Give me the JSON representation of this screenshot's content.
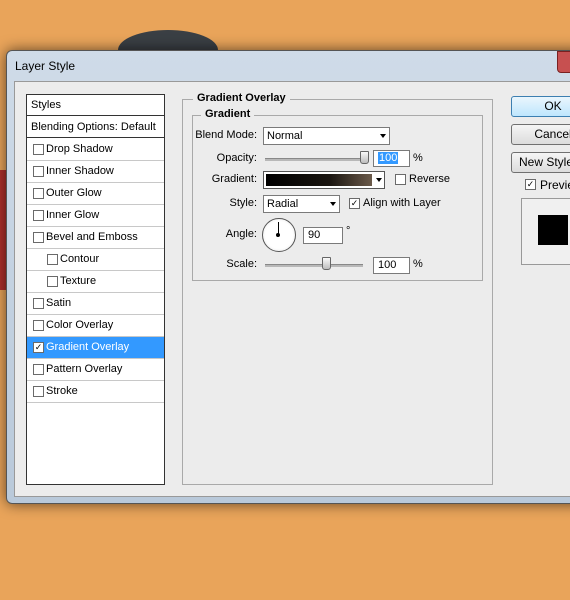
{
  "window": {
    "title": "Layer Style"
  },
  "sidebar": {
    "items": [
      {
        "label": "Styles",
        "checkbox": false,
        "checked": false
      },
      {
        "label": "Blending Options: Default",
        "checkbox": false,
        "checked": false
      },
      {
        "label": "Drop Shadow",
        "checkbox": true,
        "checked": false
      },
      {
        "label": "Inner Shadow",
        "checkbox": true,
        "checked": false
      },
      {
        "label": "Outer Glow",
        "checkbox": true,
        "checked": false
      },
      {
        "label": "Inner Glow",
        "checkbox": true,
        "checked": false
      },
      {
        "label": "Bevel and Emboss",
        "checkbox": true,
        "checked": false
      },
      {
        "label": "Contour",
        "checkbox": true,
        "checked": false
      },
      {
        "label": "Texture",
        "checkbox": true,
        "checked": false
      },
      {
        "label": "Satin",
        "checkbox": true,
        "checked": false
      },
      {
        "label": "Color Overlay",
        "checkbox": true,
        "checked": false
      },
      {
        "label": "Gradient Overlay",
        "checkbox": true,
        "checked": true
      },
      {
        "label": "Pattern Overlay",
        "checkbox": true,
        "checked": false
      },
      {
        "label": "Stroke",
        "checkbox": true,
        "checked": false
      }
    ]
  },
  "panel": {
    "section_title": "Gradient Overlay",
    "group_title": "Gradient",
    "blend_mode_label": "Blend Mode:",
    "blend_mode_value": "Normal",
    "opacity_label": "Opacity:",
    "opacity_value": "100",
    "opacity_unit": "%",
    "opacity_level": 1.0,
    "gradient_label": "Gradient:",
    "reverse_label": "Reverse",
    "reverse_checked": false,
    "style_label": "Style:",
    "style_value": "Radial",
    "align_label": "Align with Layer",
    "align_checked": true,
    "angle_label": "Angle:",
    "angle_value": "90",
    "angle_unit": "°",
    "scale_label": "Scale:",
    "scale_value": "100",
    "scale_unit": "%",
    "scale_level": 0.6
  },
  "buttons": {
    "ok": "OK",
    "cancel": "Cancel",
    "new_style": "New Style...",
    "preview_label": "Preview",
    "preview_checked": true
  },
  "colors": {
    "selection": "#3399ff",
    "background": "#e9a45a"
  }
}
